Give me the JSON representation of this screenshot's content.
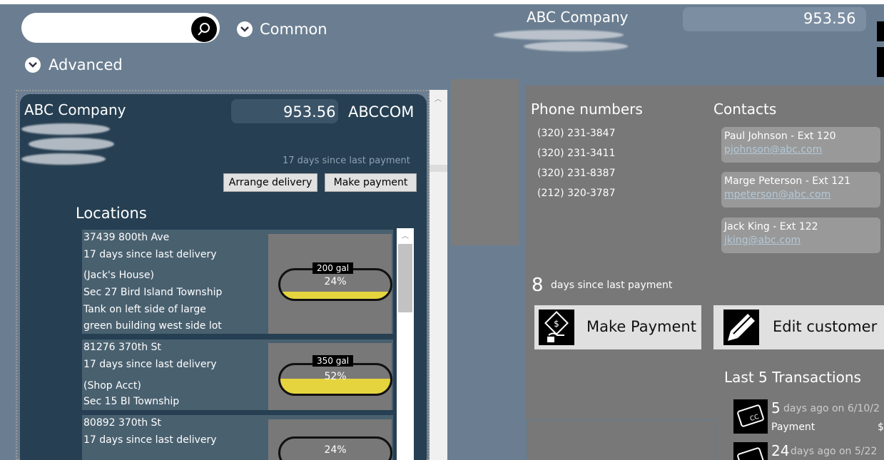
{
  "top": {
    "search": {
      "value": "",
      "placeholder": ""
    },
    "common_label": "Common",
    "advanced_label": "Advanced"
  },
  "header": {
    "company": "ABC Company",
    "balance": "953.56"
  },
  "customer_card": {
    "company": "ABC Company",
    "balance": "953.56",
    "code": "ABCCOM",
    "days_since_payment_text": "17 days since last payment",
    "arrange_delivery": "Arrange delivery",
    "make_payment": "Make payment",
    "locations_title": "Locations",
    "locations": [
      {
        "address": "37439 800th Ave",
        "delivery": "17 days since last delivery",
        "notes": [
          "(Jack's House)",
          "Sec 27 Bird Island Township",
          "Tank on left side of large",
          "green building west side lot"
        ],
        "gallons": "200 gal",
        "percent": "24%",
        "fill": 0.24
      },
      {
        "address": "81276 370th St",
        "delivery": "17 days since last delivery",
        "notes": [
          "(Shop Acct)",
          "Sec 15 BI Township"
        ],
        "gallons": "350 gal",
        "percent": "52%",
        "fill": 0.52
      },
      {
        "address": "80892 370th St",
        "delivery": "17 days since last delivery",
        "notes": [],
        "gallons": "",
        "percent": "24%",
        "fill": 0
      }
    ]
  },
  "details": {
    "phone_title": "Phone numbers",
    "phones": [
      "(320) 231-3847",
      "(320) 231-3411",
      "(320) 231-8387",
      "(212) 320-3787"
    ],
    "contacts_title": "Contacts",
    "contacts": [
      {
        "name": "Paul Johnson  -  Ext 120",
        "email": "pjohnson@abc.com"
      },
      {
        "name": "Marge Peterson  -  Ext 121",
        "email": "mpeterson@abc.com"
      },
      {
        "name": "Jack King  -  Ext 122",
        "email": "jking@abc.com"
      }
    ],
    "days_number": "8",
    "days_label": "days since last payment",
    "make_payment": "Make Payment",
    "edit_customer": "Edit customer",
    "transactions_title": "Last 5 Transactions",
    "transactions": [
      {
        "num": "5",
        "desc": "days ago on 6/10/2",
        "type": "Payment",
        "amount": "$"
      },
      {
        "num": "24",
        "desc": "days ago on 5/22",
        "type": "",
        "amount": ""
      }
    ]
  },
  "colors": {
    "background": "#6b7e91",
    "card": "#263f52",
    "tank_fill": "#e5d43e",
    "link": "#b3c9d8"
  }
}
